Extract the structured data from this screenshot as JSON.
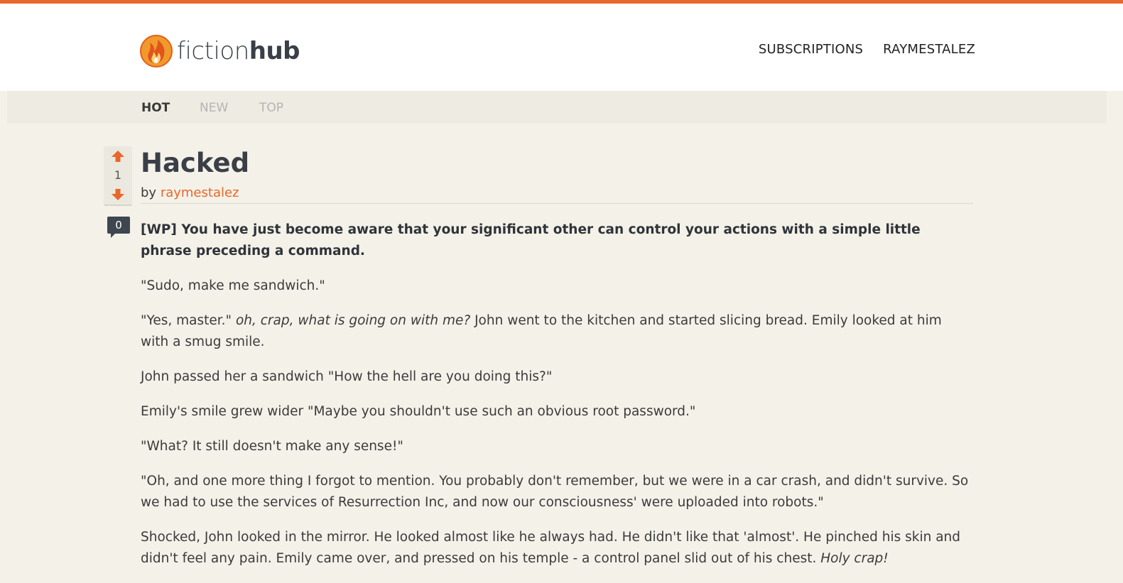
{
  "brand": {
    "name_light": "fiction",
    "name_bold": "hub",
    "accent_color": "#e8672a",
    "logo_icon": "flame-icon"
  },
  "topnav": {
    "subscriptions_label": "SUBSCRIPTIONS",
    "user_label": "RAYMESTALEZ"
  },
  "tabs": {
    "hot": "HOT",
    "new": "NEW",
    "top": "TOP",
    "active": "HOT"
  },
  "post": {
    "title": "Hacked",
    "by_label": "by",
    "author": "raymestalez",
    "score": "1",
    "comment_count": "0",
    "upvote_icon": "arrow-up-icon",
    "downvote_icon": "arrow-down-icon",
    "prompt": "[WP] You have just become aware that your significant other can control your actions with a simple little phrase preceding a command.",
    "p1": "\"Sudo, make me sandwich.\"",
    "p2_a": "\"Yes, master.\" ",
    "p2_em": "oh, crap, what is going on with me?",
    "p2_b": " John went to the kitchen and started slicing bread. Emily looked at him with a smug smile.",
    "p3": "John passed her a sandwich \"How the hell are you doing this?\"",
    "p4": "Emily's smile grew wider \"Maybe you shouldn't use such an obvious root password.\"",
    "p5": "\"What? It still doesn't make any sense!\"",
    "p6": "\"Oh, and one more thing I forgot to mention. You probably don't remember, but we were in a car crash, and didn't survive. So we had to use the services of Resurrection Inc, and now our consciousness' were uploaded into robots.\"",
    "p7_a": "Shocked, John looked in the mirror. He looked almost like he always had. He didn't like that 'almost'. He pinched his skin and didn't feel any pain. Emily came over, and pressed on his temple - a control panel slid out of his chest. ",
    "p7_em": "Holy crap!"
  }
}
